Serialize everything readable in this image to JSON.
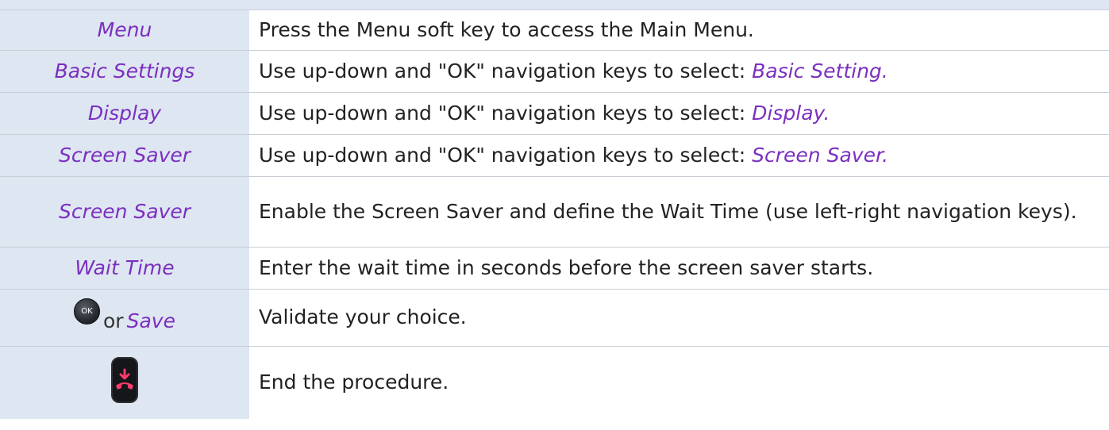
{
  "rows": [
    {
      "label": "Menu",
      "text": "Press the Menu soft key to access the Main Menu."
    },
    {
      "label": "Basic Settings",
      "text": "Use up-down and \"OK\" navigation keys to select: ",
      "emph": "Basic Setting."
    },
    {
      "label": "Display",
      "text": "Use up-down and \"OK\" navigation keys to select: ",
      "emph": "Display."
    },
    {
      "label": "Screen Saver",
      "text": "Use up-down and \"OK\" navigation keys to select: ",
      "emph": "Screen Saver."
    },
    {
      "label": "Screen Saver",
      "text": "Enable the Screen Saver and define the Wait Time (use left-right navigation keys)."
    },
    {
      "label": "Wait Time",
      "text": "Enter the wait time in seconds before the screen saver starts."
    },
    {
      "ok_key": "OK",
      "or": "or",
      "save": "Save",
      "text": "Validate your choice."
    },
    {
      "key_icon": "hang-up-key-icon",
      "text": "End the procedure."
    }
  ],
  "colors": {
    "label_bg": "#dde6f1",
    "accent": "#7b2fbf",
    "hangup_red": "#ff3b6b"
  }
}
